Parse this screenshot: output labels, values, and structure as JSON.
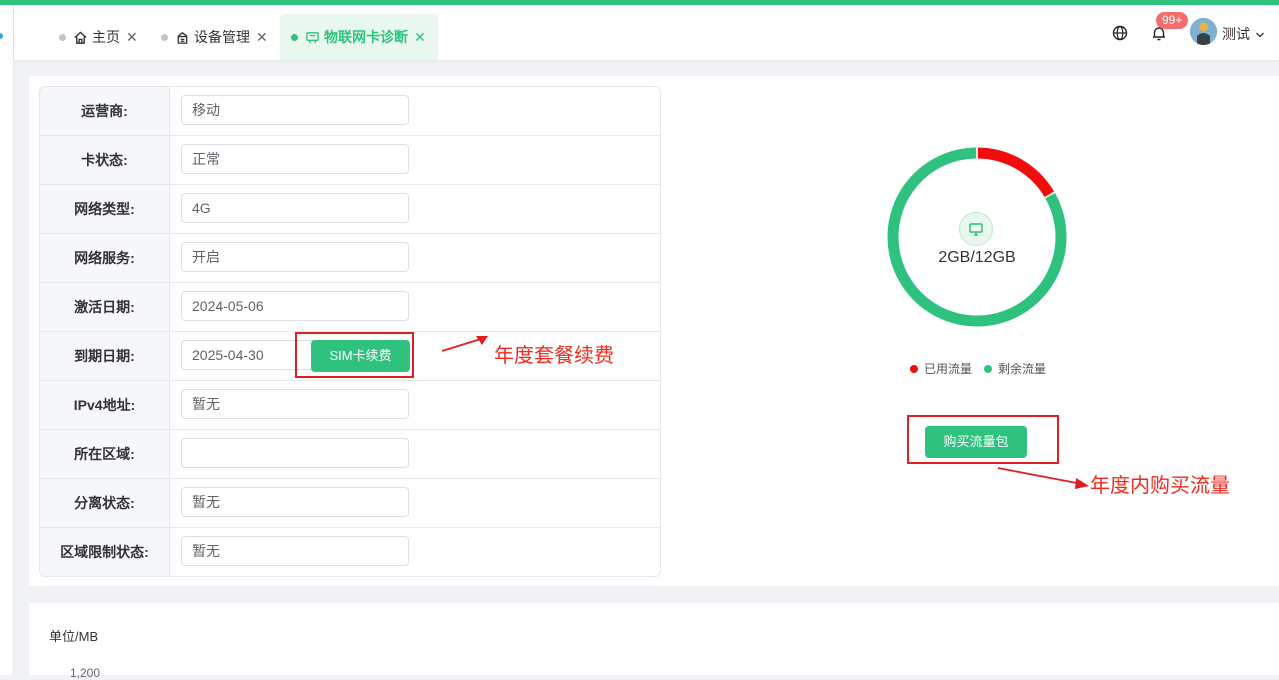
{
  "tabs": [
    {
      "label": "主页",
      "icon": "home-icon"
    },
    {
      "label": "设备管理",
      "icon": "device-icon"
    },
    {
      "label": "物联网卡诊断",
      "icon": "sim-card-icon",
      "active": true
    }
  ],
  "header": {
    "notification_badge": "99+",
    "username": "测试"
  },
  "info_rows": [
    {
      "label": "运营商:",
      "value": "移动"
    },
    {
      "label": "卡状态:",
      "value": "正常"
    },
    {
      "label": "网络类型:",
      "value": "4G"
    },
    {
      "label": "网络服务:",
      "value": "开启"
    },
    {
      "label": "激活日期:",
      "value": "2024-05-06"
    },
    {
      "label": "到期日期:",
      "value": "2025-04-30"
    },
    {
      "label": "IPv4地址:",
      "value": "暂无"
    },
    {
      "label": "所在区域:",
      "value": ""
    },
    {
      "label": "分离状态:",
      "value": "暂无"
    },
    {
      "label": "区域限制状态:",
      "value": "暂无"
    }
  ],
  "buttons": {
    "renew": "SIM卡续费",
    "buy_traffic": "购买流量包"
  },
  "annotations": {
    "renew_note": "年度套餐续费",
    "buy_note": "年度内购买流量"
  },
  "chart_data": {
    "type": "pie",
    "categories": [
      "已用流量",
      "剩余流量"
    ],
    "values": [
      2,
      10
    ],
    "center_label": "2GB/12GB",
    "colors": [
      "#f20d0d",
      "#2ec27e"
    ]
  },
  "usage_chart": {
    "unit_label": "单位/MB",
    "first_tick": "1,200"
  },
  "colors": {
    "accent": "#2ec27e",
    "alert": "#f02a1f"
  }
}
